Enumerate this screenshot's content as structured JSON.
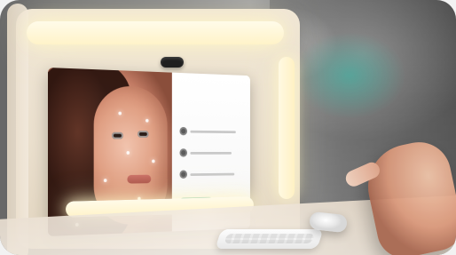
{
  "scene": {
    "type": "photo",
    "subject": "kiosk-with-face-analysis-screen"
  },
  "screen": {
    "header_small": "",
    "header_title": "",
    "rows": [
      {
        "icon": "user-icon",
        "text": ""
      },
      {
        "icon": "user-icon",
        "text": ""
      },
      {
        "icon": "user-icon",
        "text": ""
      }
    ],
    "cta_label": ""
  }
}
